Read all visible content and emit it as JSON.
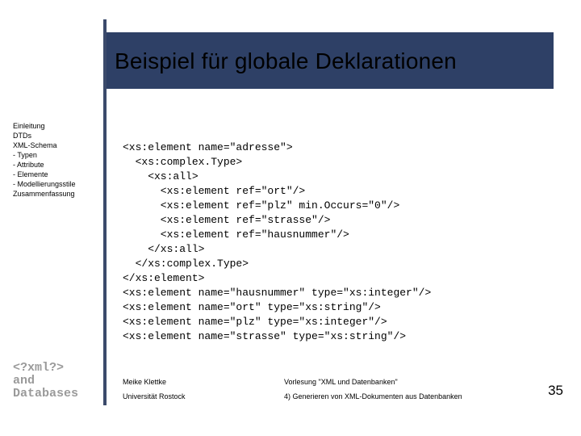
{
  "title": "Beispiel für globale Deklarationen",
  "outline": {
    "items": [
      "Einleitung",
      "DTDs",
      "XML-Schema",
      "- Typen",
      "- Attribute",
      "- Elemente",
      "- Modellierungsstile",
      "Zusammenfassung"
    ]
  },
  "code": "<xs:element name=\"adresse\">\n  <xs:complex.Type>\n    <xs:all>\n      <xs:element ref=\"ort\"/>\n      <xs:element ref=\"plz\" min.Occurs=\"0\"/>\n      <xs:element ref=\"strasse\"/>\n      <xs:element ref=\"hausnummer\"/>\n    </xs:all>\n  </xs:complex.Type>\n</xs:element>\n<xs:element name=\"hausnummer\" type=\"xs:integer\"/>\n<xs:element name=\"ort\" type=\"xs:string\"/>\n<xs:element name=\"plz\" type=\"xs:integer\"/>\n<xs:element name=\"strasse\" type=\"xs:string\"/>",
  "logo": {
    "line1": "<?xml?>",
    "line2": "and",
    "line3": "Databases"
  },
  "footer": {
    "author": "Meike Klettke",
    "institution": "Universität Rostock",
    "lecture": "Vorlesung \"XML und Datenbanken\"",
    "chapter": "4) Generieren von XML-Dokumenten aus Datenbanken"
  },
  "page": "35"
}
